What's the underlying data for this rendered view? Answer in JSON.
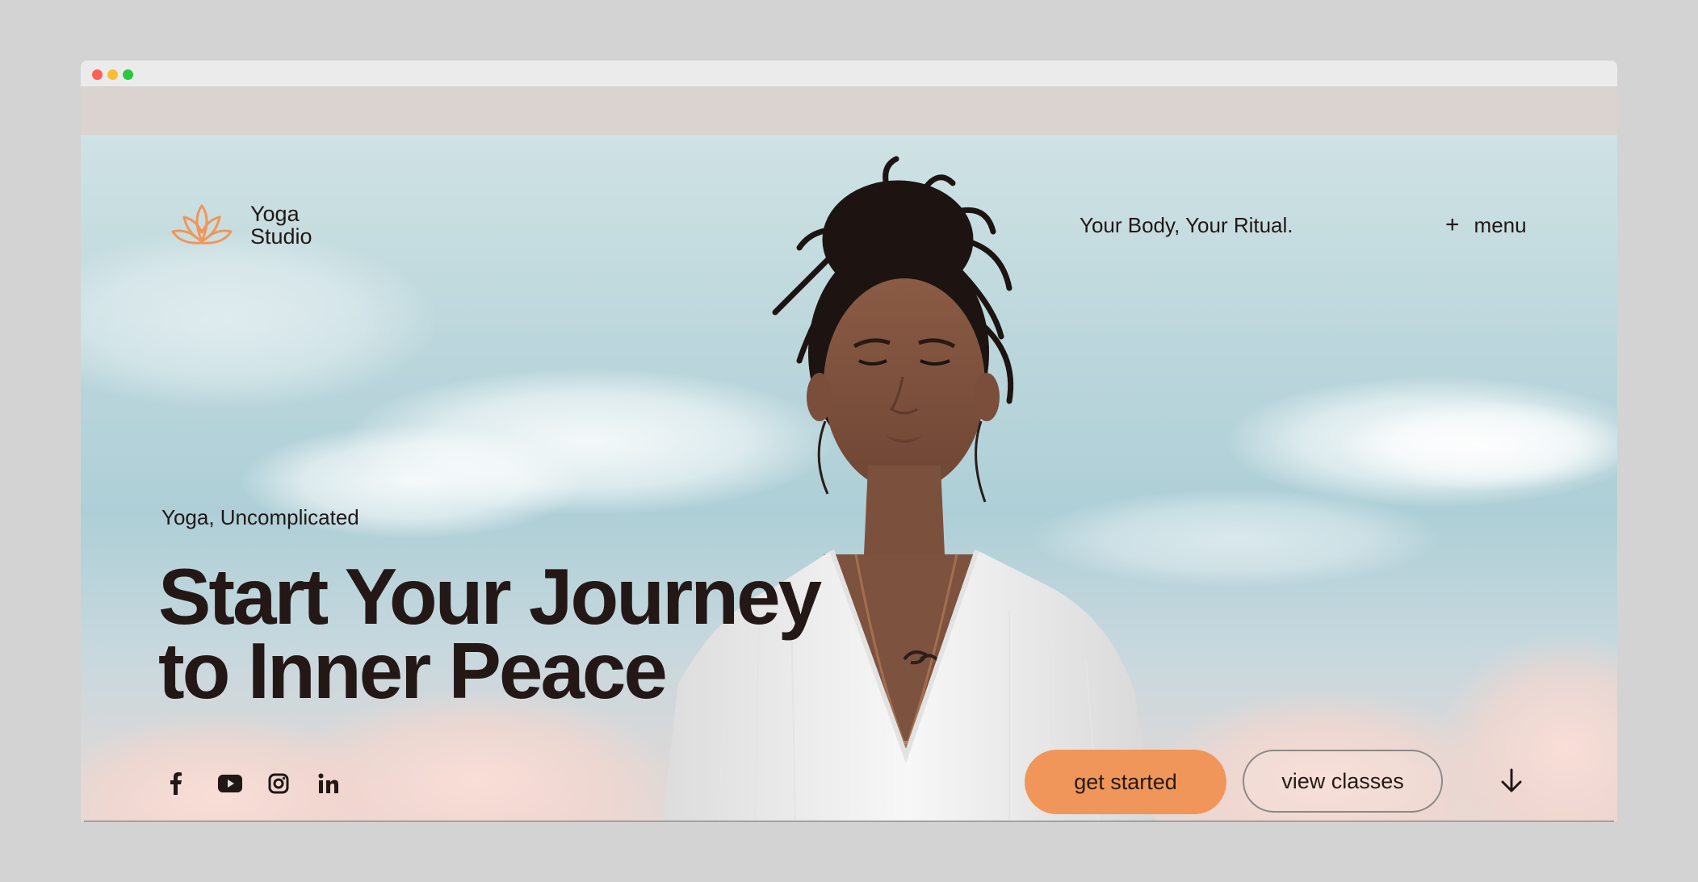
{
  "window": {
    "controls": [
      "close",
      "minimize",
      "maximize"
    ]
  },
  "brand": {
    "name_line1": "Yoga",
    "name_line2": "Studio",
    "logo_icon": "lotus-icon",
    "accent_color": "#f0965a"
  },
  "header": {
    "tagline": "Your Body, Your Ritual.",
    "menu_label": "menu",
    "menu_icon": "plus-icon"
  },
  "hero": {
    "eyebrow": "Yoga, Uncomplicated",
    "headline_line1": "Start Your Journey",
    "headline_line2": "to Inner Peace",
    "primary_cta": "get started",
    "secondary_cta": "view classes",
    "scroll_icon": "arrow-down-icon"
  },
  "socials": [
    {
      "icon": "facebook-icon"
    },
    {
      "icon": "youtube-icon"
    },
    {
      "icon": "instagram-icon"
    },
    {
      "icon": "linkedin-icon"
    }
  ]
}
